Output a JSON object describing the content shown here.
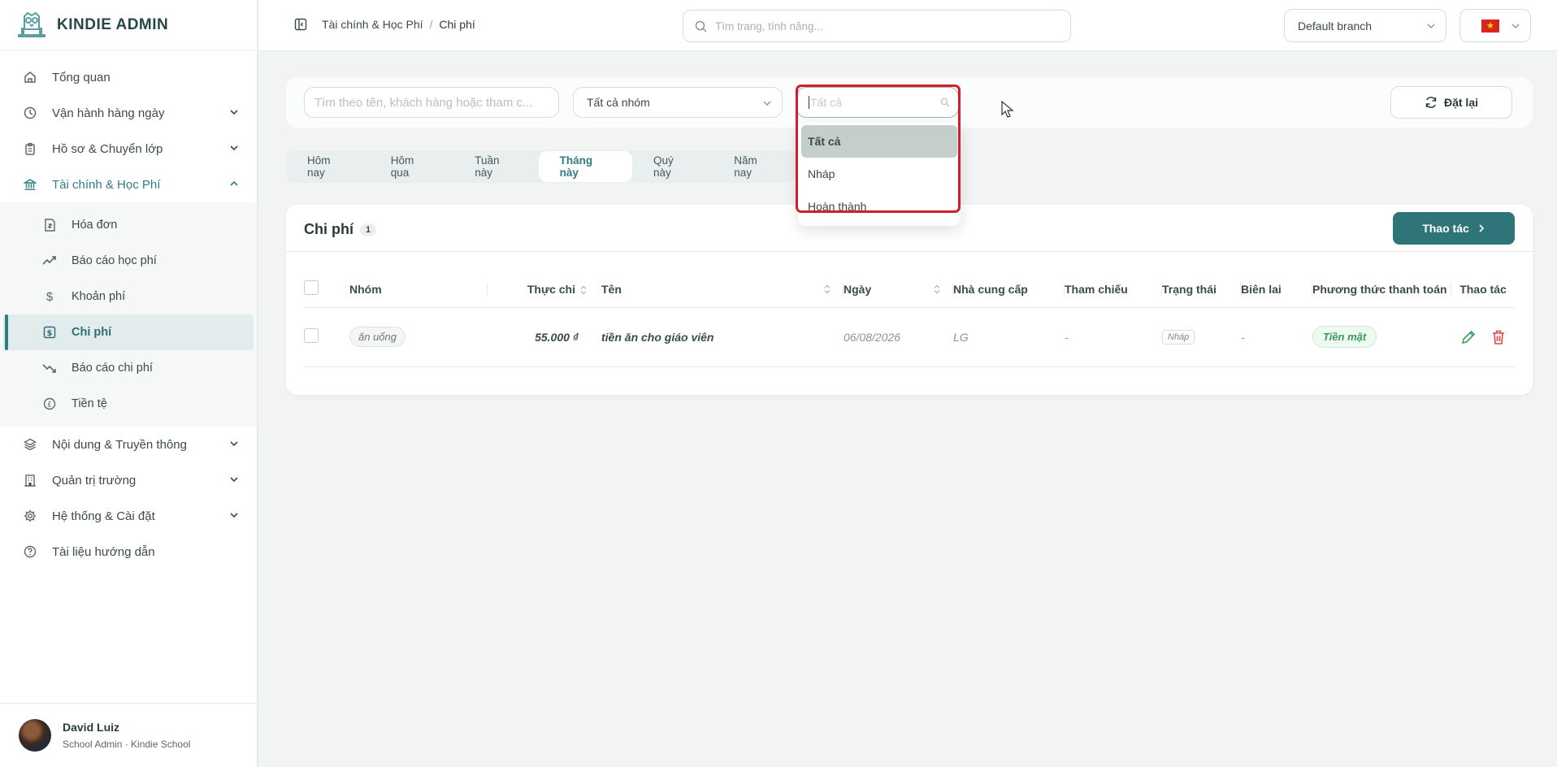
{
  "brand": {
    "name": "KINDIE ADMIN"
  },
  "sidebar": {
    "items": [
      {
        "label": "Tổng quan",
        "icon": "home-icon"
      },
      {
        "label": "Vận hành hàng ngày",
        "icon": "clock-icon"
      },
      {
        "label": "Hồ sơ & Chuyển lớp",
        "icon": "clipboard-icon"
      },
      {
        "label": "Tài chính & Học Phí",
        "icon": "bank-icon"
      },
      {
        "label": "Nội dung & Truyền thông",
        "icon": "layers-icon"
      },
      {
        "label": "Quản trị trường",
        "icon": "building-icon"
      },
      {
        "label": "Hệ thống & Cài đặt",
        "icon": "gear-icon"
      },
      {
        "label": "Tài liệu hướng dẫn",
        "icon": "help-icon"
      }
    ],
    "sub_items": [
      {
        "label": "Hóa đơn",
        "icon": "invoice-icon"
      },
      {
        "label": "Báo cáo học phí",
        "icon": "trend-up-icon"
      },
      {
        "label": "Khoản phí",
        "icon": "dollar-icon"
      },
      {
        "label": "Chi phí",
        "icon": "expense-icon"
      },
      {
        "label": "Báo cáo chi phí",
        "icon": "trend-down-icon"
      },
      {
        "label": "Tiền tệ",
        "icon": "currency-icon"
      }
    ]
  },
  "user": {
    "name": "David Luiz",
    "role": "School Admin · Kindie School"
  },
  "topbar": {
    "breadcrumb": [
      "Tài chính & Học Phí",
      "/",
      "Chi phí"
    ],
    "search_placeholder": "Tìm trang, tính năng...",
    "branch": "Default branch"
  },
  "filters": {
    "search_placeholder": "Tìm theo tên, khách hàng hoặc tham c...",
    "group": "Tất cả nhóm",
    "status_placeholder": "Tất cả",
    "reset_label": "Đặt lại"
  },
  "dropdown": {
    "options": [
      "Tất cả",
      "Nháp",
      "Hoàn thành"
    ]
  },
  "periods": [
    "Hôm nay",
    "Hôm qua",
    "Tuần này",
    "Tháng này",
    "Quý này",
    "Năm nay"
  ],
  "card": {
    "title": "Chi phí",
    "count": "1",
    "action_label": "Thao tác",
    "columns": [
      "Nhóm",
      "Thực chi",
      "Tên",
      "Ngày",
      "Nhà cung cấp",
      "Tham chiếu",
      "Trạng thái",
      "Biên lai",
      "Phương thức thanh toán",
      "Thao tác"
    ],
    "rows": [
      {
        "group": "ăn uống",
        "amount": "55.000 ₫",
        "name": "tiền ăn cho giáo viên",
        "date": "06/08/2026",
        "supplier": "LG",
        "reference": "-",
        "status": "Nháp",
        "receipt": "-",
        "payment": "Tiền mặt"
      }
    ]
  },
  "colors": {
    "accent": "#2f7479",
    "highlight": "#d0202a",
    "delete": "#d84a4a"
  }
}
